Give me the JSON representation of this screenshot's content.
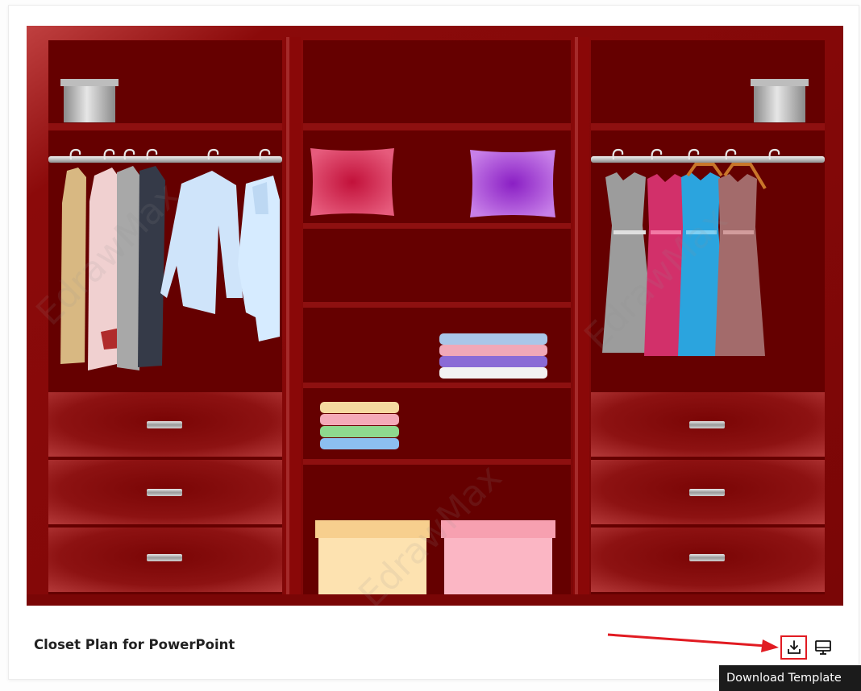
{
  "template": {
    "title": "Closet Plan for PowerPoint"
  },
  "actions": {
    "download_icon": "download-icon",
    "present_icon": "monitor-icon",
    "tooltip": "Download Template"
  },
  "watermark_text": "EdrawMax",
  "colors": {
    "closet": "#6a0000",
    "accent": "#e11b22"
  }
}
